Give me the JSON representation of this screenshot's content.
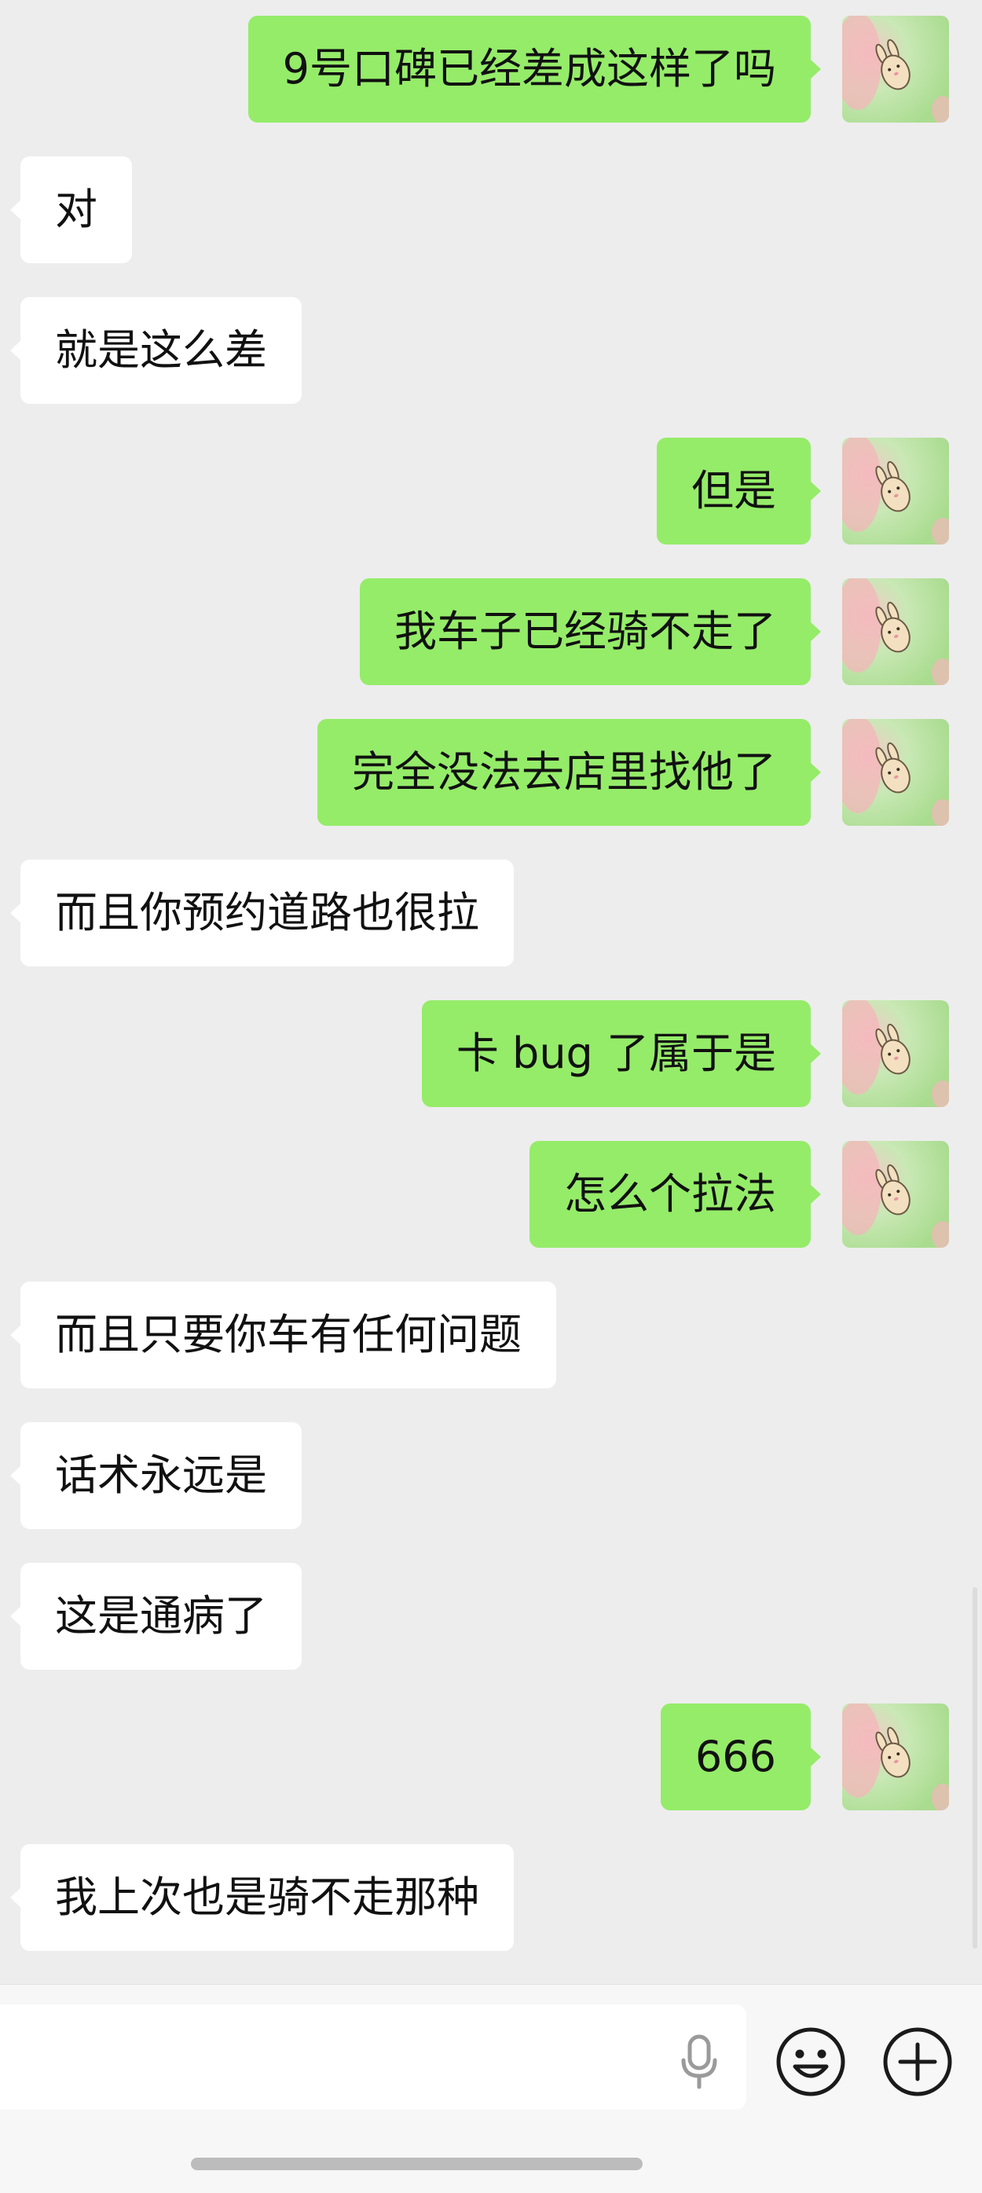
{
  "conversation": {
    "messages": [
      {
        "side": "me",
        "text": "9号口碑已经差成这样了吗"
      },
      {
        "side": "them",
        "text": "对"
      },
      {
        "side": "them",
        "text": "就是这么差"
      },
      {
        "side": "me",
        "text": "但是"
      },
      {
        "side": "me",
        "text": "我车子已经骑不走了"
      },
      {
        "side": "me",
        "text": "完全没法去店里找他了"
      },
      {
        "side": "them",
        "text": "而且你预约道路也很拉"
      },
      {
        "side": "me",
        "text": "卡 bug 了属于是"
      },
      {
        "side": "me",
        "text": "怎么个拉法"
      },
      {
        "side": "them",
        "text": "而且只要你车有任何问题"
      },
      {
        "side": "them",
        "text": "话术永远是"
      },
      {
        "side": "them",
        "text": "这是通病了"
      },
      {
        "side": "me",
        "text": "666"
      },
      {
        "side": "them",
        "text": "我上次也是骑不走那种"
      }
    ]
  },
  "colors": {
    "background": "#ededed",
    "my_bubble": "#95ec69",
    "their_bubble": "#ffffff",
    "text": "#111111",
    "icon_stroke": "#1a1a1a"
  },
  "icons": {
    "mic": "microphone-icon",
    "emoji": "smiley-icon",
    "plus": "plus-icon",
    "avatar": "bunny-avatar"
  },
  "input": {
    "value": "",
    "placeholder": ""
  }
}
